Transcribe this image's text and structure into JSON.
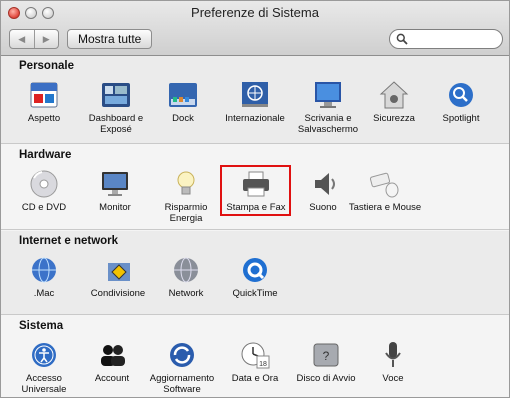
{
  "window": {
    "title": "Preferenze di Sistema"
  },
  "toolbar": {
    "back_label": "◀",
    "forward_label": "▶",
    "show_all_label": "Mostra tutte",
    "search_placeholder": ""
  },
  "sections": [
    {
      "title": "Personale",
      "items": [
        {
          "label": "Aspetto",
          "icon": "appearance-icon"
        },
        {
          "label": "Dashboard e Exposé",
          "icon": "dashboard-icon"
        },
        {
          "label": "Dock",
          "icon": "dock-icon"
        },
        {
          "label": "Internazionale",
          "icon": "globe-flag-icon"
        },
        {
          "label": "Scrivania e Salvaschermo",
          "icon": "desktop-icon"
        },
        {
          "label": "Sicurezza",
          "icon": "house-lock-icon"
        },
        {
          "label": "Spotlight",
          "icon": "spotlight-icon"
        }
      ]
    },
    {
      "title": "Hardware",
      "items": [
        {
          "label": "CD e DVD",
          "icon": "disc-icon"
        },
        {
          "label": "Monitor",
          "icon": "monitor-icon"
        },
        {
          "label": "Risparmio Energia",
          "icon": "lightbulb-icon"
        },
        {
          "label": "Stampa e Fax",
          "icon": "printer-icon"
        },
        {
          "label": "Suono",
          "icon": "speaker-icon"
        },
        {
          "label": "Tastiera e Mouse",
          "icon": "keyboard-mouse-icon"
        }
      ]
    },
    {
      "title": "Internet e network",
      "items": [
        {
          "label": ".Mac",
          "icon": "mac-globe-icon"
        },
        {
          "label": "Condivisione",
          "icon": "sharing-icon"
        },
        {
          "label": "Network",
          "icon": "network-icon"
        },
        {
          "label": "QuickTime",
          "icon": "quicktime-icon"
        }
      ]
    },
    {
      "title": "Sistema",
      "items": [
        {
          "label": "Accesso Universale",
          "icon": "accessibility-icon"
        },
        {
          "label": "Account",
          "icon": "accounts-icon"
        },
        {
          "label": "Aggiornamento Software",
          "icon": "software-update-icon"
        },
        {
          "label": "Data e Ora",
          "icon": "clock-icon"
        },
        {
          "label": "Disco di Avvio",
          "icon": "startup-disk-icon"
        },
        {
          "label": "Voce",
          "icon": "microphone-icon"
        }
      ]
    }
  ],
  "calendar_day": "18"
}
